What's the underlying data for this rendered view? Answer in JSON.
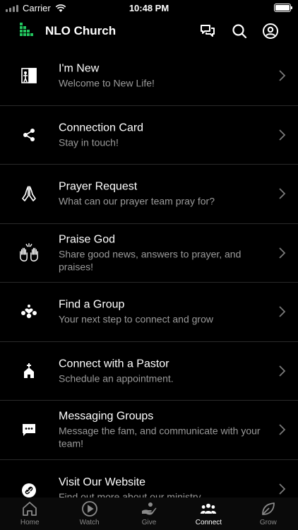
{
  "status": {
    "carrier": "Carrier",
    "time": "10:48 PM"
  },
  "header": {
    "title": "NLO Church"
  },
  "colors": {
    "accent": "#22c55e",
    "background": "#000000",
    "subtitle": "#9a9a9a"
  },
  "items": [
    {
      "title": "I'm New",
      "subtitle": "Welcome to New Life!",
      "icon": "door-icon"
    },
    {
      "title": "Connection Card",
      "subtitle": "Stay in touch!",
      "icon": "share-icon"
    },
    {
      "title": "Prayer Request",
      "subtitle": "What can our prayer team pray for?",
      "icon": "praying-hands-icon"
    },
    {
      "title": "Praise God",
      "subtitle": "Share good news, answers to prayer, and praises!",
      "icon": "raised-hands-icon"
    },
    {
      "title": "Find a Group",
      "subtitle": "Your next step to connect and grow",
      "icon": "group-heart-icon"
    },
    {
      "title": "Connect with a Pastor",
      "subtitle": "Schedule an appointment.",
      "icon": "chapel-icon"
    },
    {
      "title": "Messaging Groups",
      "subtitle": "Message the fam, and communicate with your team!",
      "icon": "message-icon"
    },
    {
      "title": "Visit Our Website",
      "subtitle": "Find out more about our ministry",
      "icon": "link-icon"
    }
  ],
  "tabs": [
    {
      "label": "Home",
      "icon": "home-icon"
    },
    {
      "label": "Watch",
      "icon": "play-icon"
    },
    {
      "label": "Give",
      "icon": "give-icon"
    },
    {
      "label": "Connect",
      "icon": "people-icon",
      "active": true
    },
    {
      "label": "Grow",
      "icon": "leaf-icon"
    }
  ]
}
